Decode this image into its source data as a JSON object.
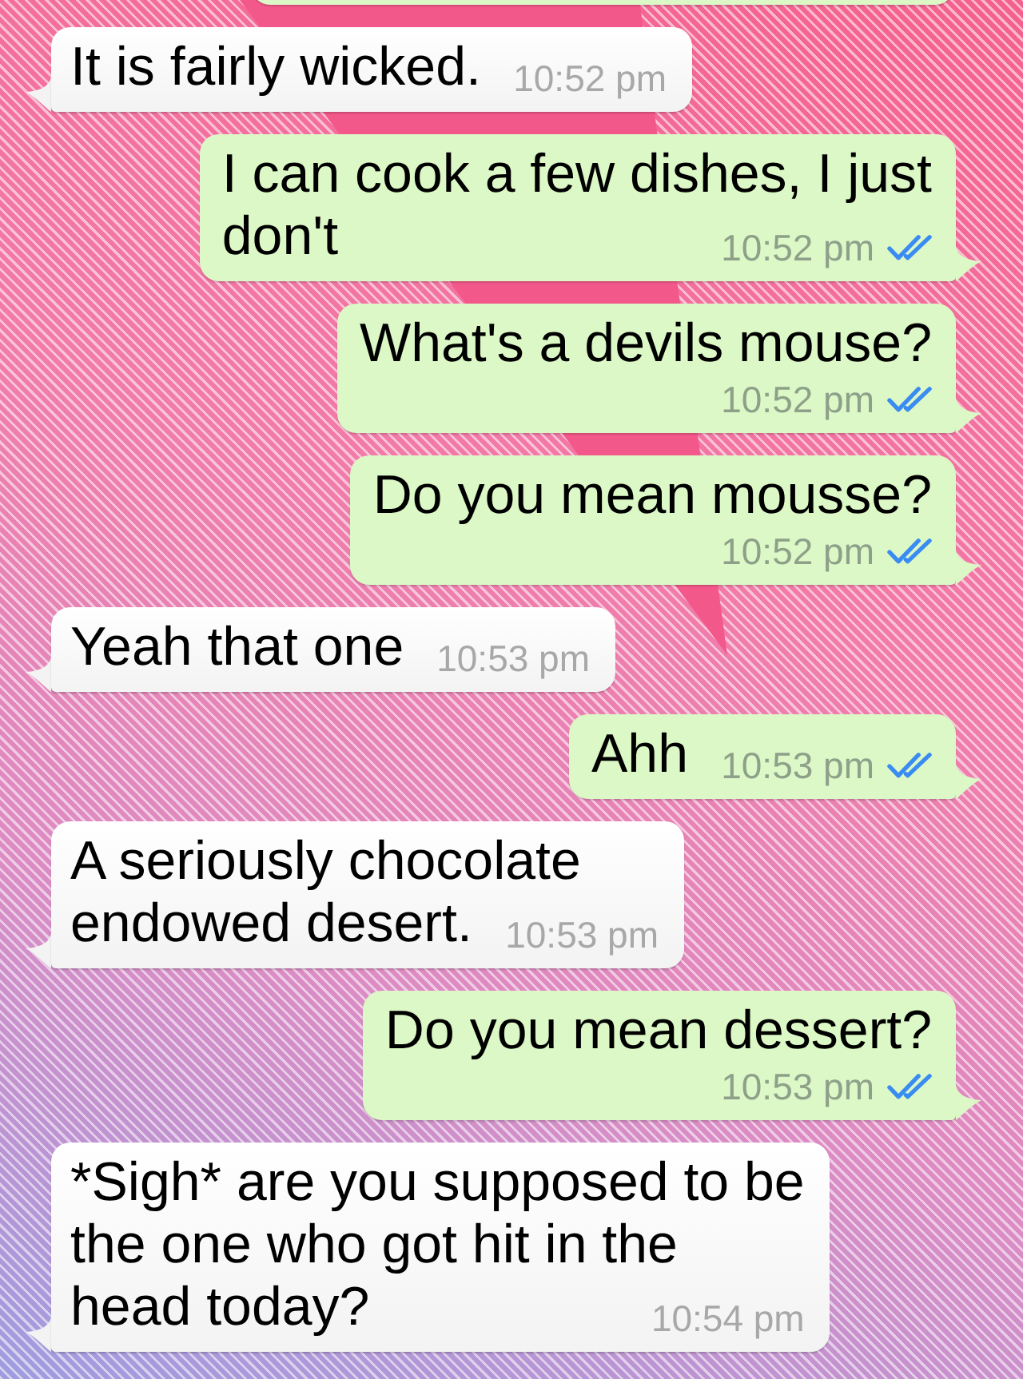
{
  "messages": [
    {
      "kind": "incoming",
      "lines": [
        "It is fairly wicked."
      ],
      "time": "10:52 pm"
    },
    {
      "kind": "outgoing",
      "lines": [
        "I can cook a few dishes, I just",
        "don't"
      ],
      "time": "10:52 pm",
      "read": true
    },
    {
      "kind": "outgoing",
      "lines": [
        "What's a devils mouse?"
      ],
      "time": "10:52 pm",
      "read": true
    },
    {
      "kind": "outgoing",
      "lines": [
        "Do you mean mousse?"
      ],
      "time": "10:52 pm",
      "read": true
    },
    {
      "kind": "incoming",
      "lines": [
        "Yeah that one"
      ],
      "time": "10:53 pm"
    },
    {
      "kind": "outgoing",
      "lines": [
        "Ahh"
      ],
      "time": "10:53 pm",
      "read": true
    },
    {
      "kind": "incoming",
      "lines": [
        "A seriously chocolate",
        "endowed desert."
      ],
      "time": "10:53 pm"
    },
    {
      "kind": "outgoing",
      "lines": [
        "Do you mean dessert?"
      ],
      "time": "10:53 pm",
      "read": true
    },
    {
      "kind": "incoming",
      "lines": [
        "*Sigh* are you supposed to be",
        "the one who got hit in the",
        "head today?"
      ],
      "time": "10:54 pm"
    }
  ]
}
